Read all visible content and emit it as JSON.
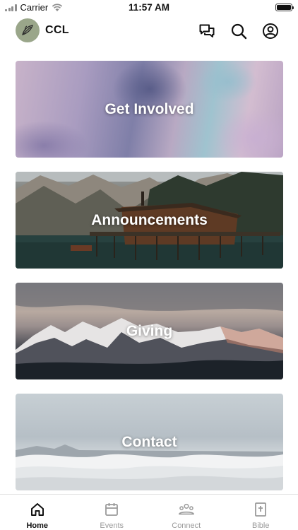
{
  "status_bar": {
    "carrier": "Carrier",
    "time": "11:57 AM"
  },
  "header": {
    "app_name": "CCL",
    "icons": [
      "chat-icon",
      "search-icon",
      "profile-icon"
    ]
  },
  "cards": [
    {
      "label": "Get Involved"
    },
    {
      "label": "Announcements"
    },
    {
      "label": "Giving"
    },
    {
      "label": "Contact"
    }
  ],
  "tab_bar": {
    "tabs": [
      {
        "label": "Home",
        "icon": "home-icon",
        "active": true
      },
      {
        "label": "Events",
        "icon": "calendar-icon",
        "active": false
      },
      {
        "label": "Connect",
        "icon": "group-icon",
        "active": false
      },
      {
        "label": "Bible",
        "icon": "bible-icon",
        "active": false
      }
    ]
  },
  "colors": {
    "accent": "#111111",
    "inactive": "#9a9a9a",
    "avatar_bg": "#9aa68a"
  }
}
